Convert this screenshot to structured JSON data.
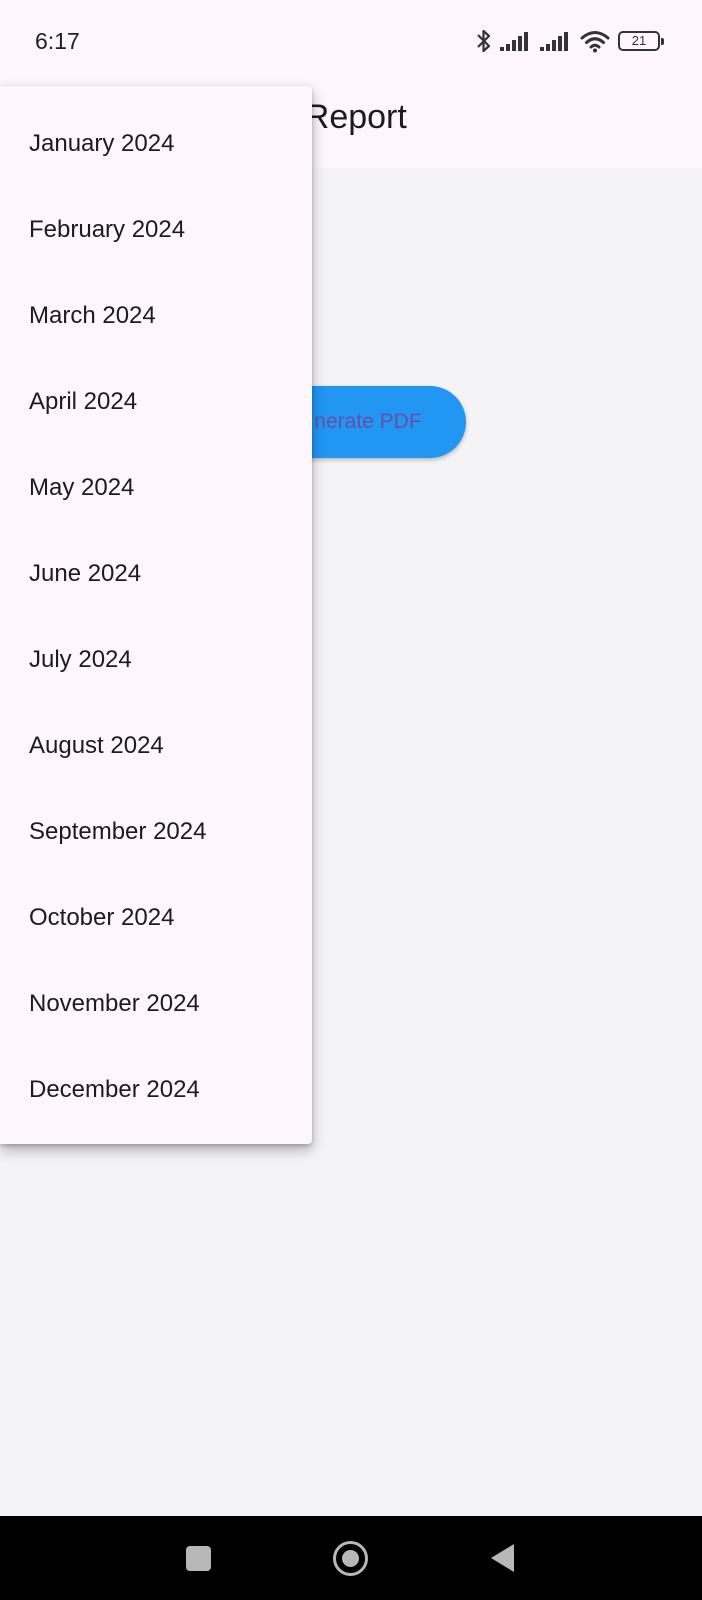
{
  "status_bar": {
    "time": "6:17",
    "battery_level": "21",
    "icons": [
      "bluetooth-icon",
      "signal-icon",
      "signal-icon",
      "wifi-icon",
      "battery-icon"
    ]
  },
  "app_bar": {
    "title": "DF Report"
  },
  "main": {
    "generate_button_label": "nerate PDF",
    "button_color": "#2196f3",
    "button_text_color": "#6750a4"
  },
  "dropdown": {
    "items": [
      "January 2024",
      "February 2024",
      "March 2024",
      "April 2024",
      "May 2024",
      "June 2024",
      "July 2024",
      "August 2024",
      "September 2024",
      "October 2024",
      "November 2024",
      "December 2024"
    ]
  },
  "nav_bar": {
    "icons": [
      "recents-icon",
      "home-icon",
      "back-icon"
    ]
  },
  "colors": {
    "surface": "#fdf7fd",
    "background": "#f4f4f6",
    "nav_bar": "#000000"
  }
}
